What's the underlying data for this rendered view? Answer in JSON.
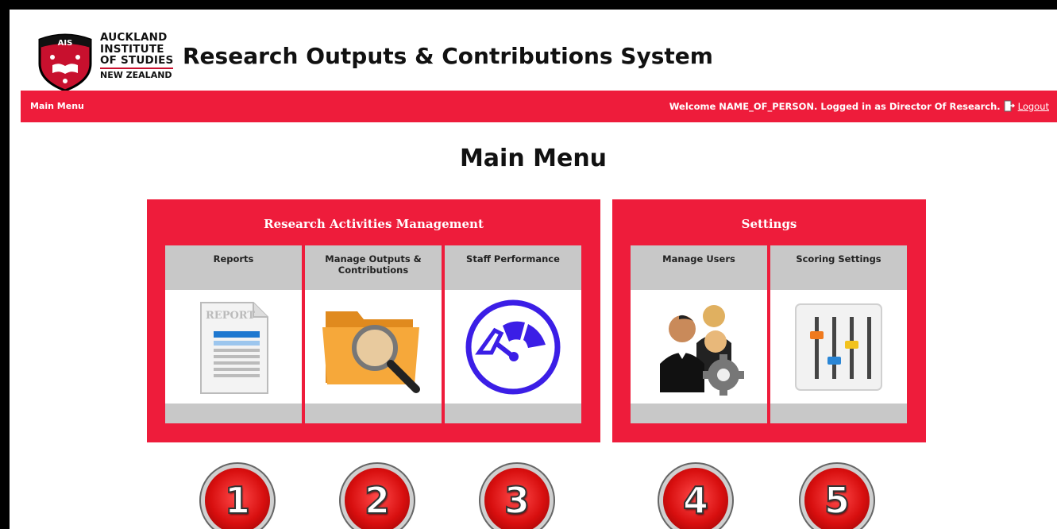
{
  "header": {
    "logo_lines": [
      "AUCKLAND",
      "INSTITUTE",
      "OF STUDIES",
      "NEW ZEALAND"
    ],
    "logo_badge": "AIS",
    "app_title": "Research Outputs & Contributions System"
  },
  "navbar": {
    "left_link": "Main Menu",
    "welcome_text": "Welcome NAME_OF_PERSON. Logged in as Director Of Research.",
    "logout_label": "Logout"
  },
  "page_title": "Main Menu",
  "panels": [
    {
      "title": "Research Activities Management",
      "cards": [
        {
          "label": "Reports",
          "icon": "report-document-icon"
        },
        {
          "label": "Manage Outputs & Contributions",
          "icon": "folder-search-icon"
        },
        {
          "label": "Staff Performance",
          "icon": "gauge-icon"
        }
      ]
    },
    {
      "title": "Settings",
      "cards": [
        {
          "label": "Manage Users",
          "icon": "users-gear-icon"
        },
        {
          "label": "Scoring Settings",
          "icon": "sliders-icon"
        }
      ]
    }
  ],
  "numbers": [
    "1",
    "2",
    "3",
    "4",
    "5"
  ],
  "colors": {
    "brand_red": "#ee1c3b",
    "card_grey": "#c8c8c8",
    "gauge_purple": "#3b1ee6"
  }
}
